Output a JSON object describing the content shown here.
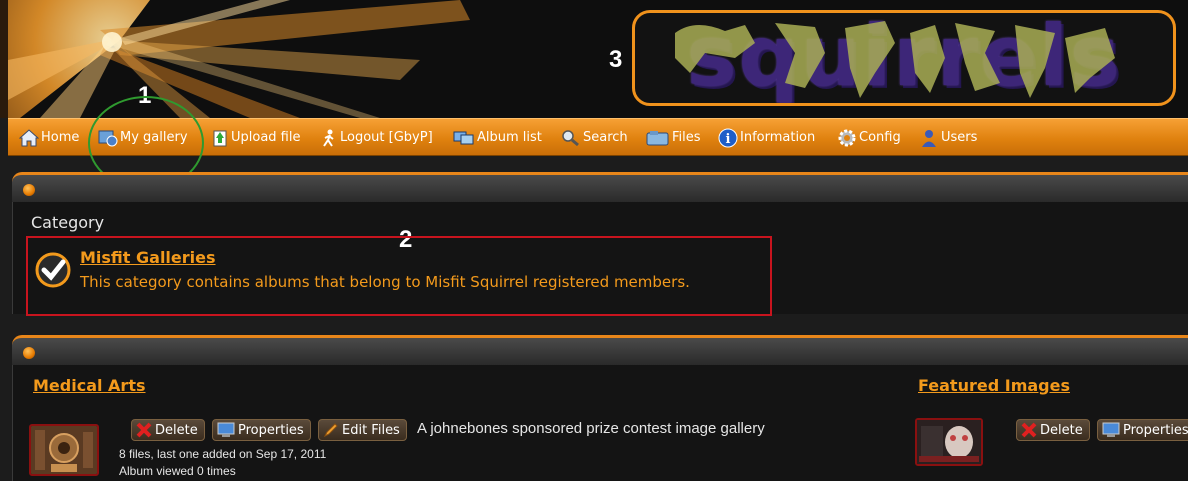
{
  "header": {
    "logo_text": "squirrels",
    "annotation_numbers": [
      "1",
      "2",
      "3"
    ]
  },
  "nav": {
    "items": [
      {
        "label": "Home",
        "icon": "home-icon"
      },
      {
        "label": "My gallery",
        "icon": "my-gallery-icon"
      },
      {
        "label": "Upload file",
        "icon": "upload-icon"
      },
      {
        "label": "Logout [GbyP]",
        "icon": "logout-icon"
      },
      {
        "label": "Album list",
        "icon": "album-list-icon"
      },
      {
        "label": "Search",
        "icon": "search-icon"
      },
      {
        "label": "Files",
        "icon": "files-icon"
      },
      {
        "label": "Information",
        "icon": "information-icon"
      },
      {
        "label": "Config",
        "icon": "config-icon"
      },
      {
        "label": "Users",
        "icon": "users-icon"
      }
    ]
  },
  "category": {
    "heading": "Category",
    "name": "Misfit Galleries",
    "description": "This category contains albums that belong to Misfit Squirrel registered members."
  },
  "albums": [
    {
      "title": "Medical Arts",
      "buttons": [
        "Delete",
        "Properties",
        "Edit Files"
      ],
      "description": "A johnebones sponsored prize contest image gallery",
      "files_info": "8 files, last one added on Sep 17, 2011",
      "views": "Album viewed 0 times"
    },
    {
      "title": "Featured Images",
      "buttons": [
        "Delete",
        "Properties"
      ]
    }
  ],
  "colors": {
    "accent": "#f39a1c",
    "nav_bar": "#e8861a",
    "annotation_red": "#c8141e",
    "annotation_green": "#2f9a2f",
    "logo_border": "#f0921c"
  }
}
